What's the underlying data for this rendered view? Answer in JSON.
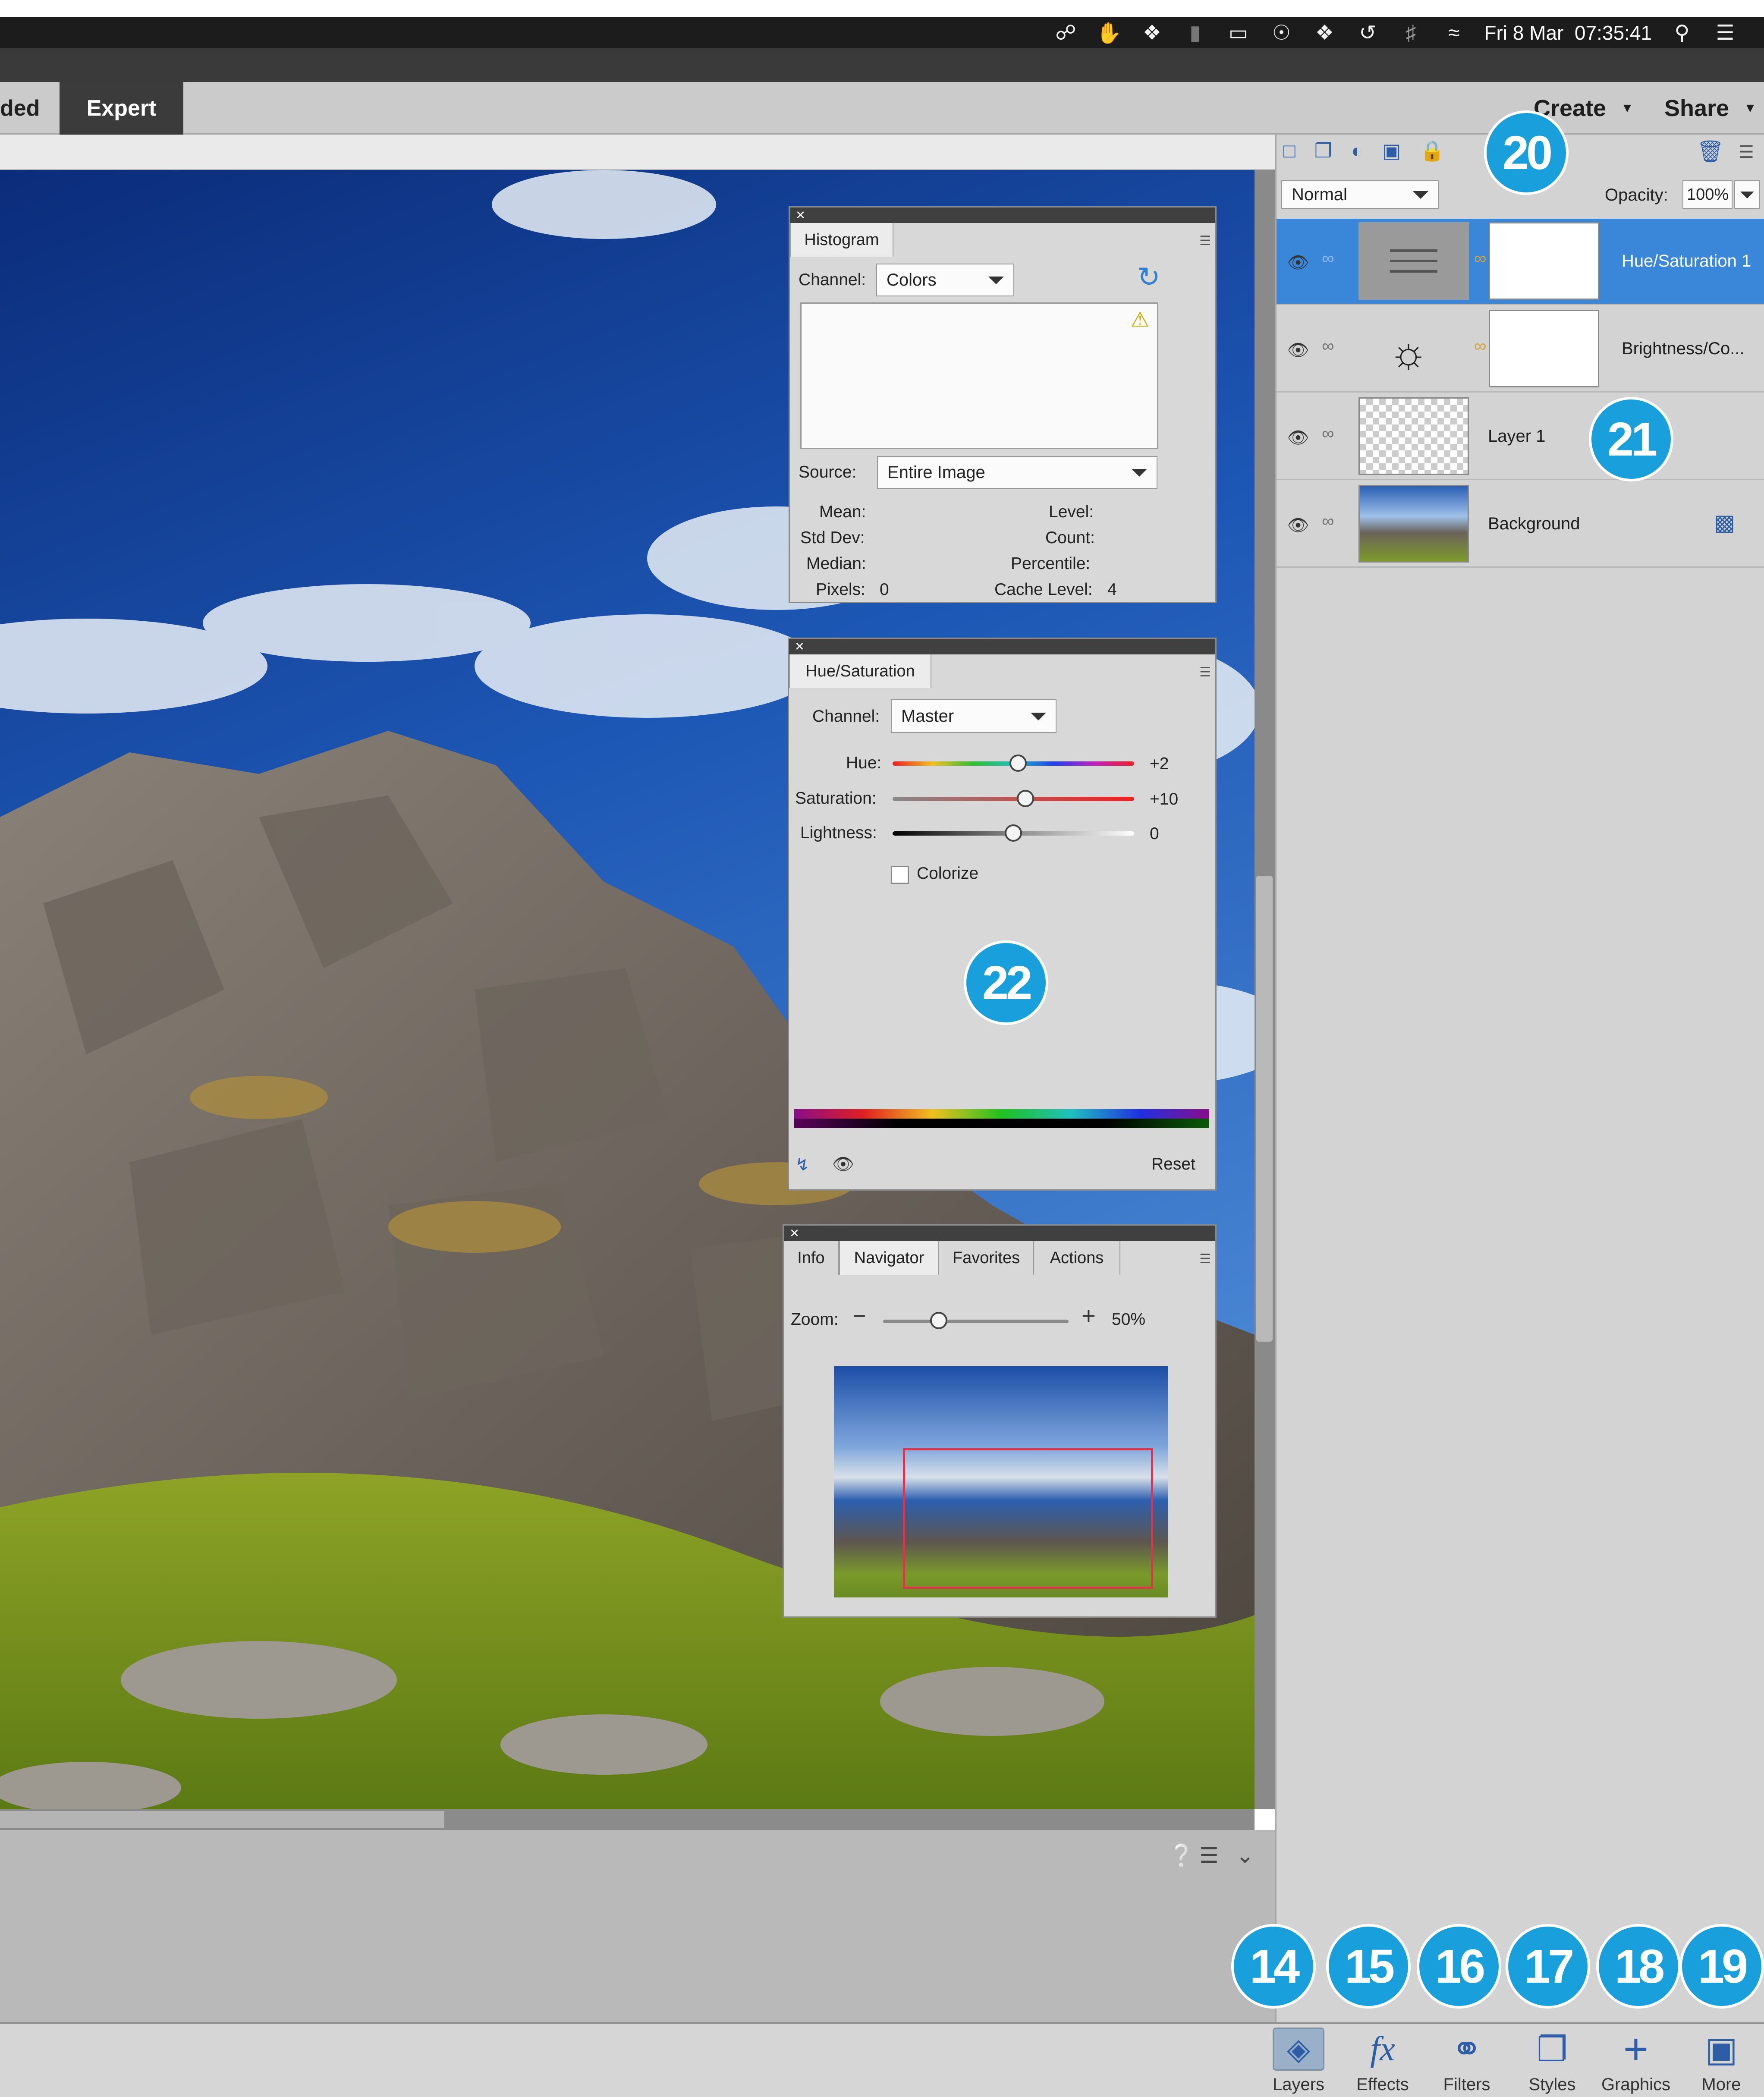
{
  "menubar": {
    "icons": [
      "creative-cloud-icon",
      "hand-icon",
      "dropbox-icon",
      "battery-icon",
      "airplay-icon",
      "accessibility-icon",
      "dropbox-alt-icon",
      "time-machine-icon",
      "bluetooth-icon",
      "wifi-icon"
    ],
    "clock": "Fri 8 Mar  07:35:41",
    "search_icon": "search-icon",
    "list_icon": "list-icon"
  },
  "modes": {
    "guided_partial": "ded",
    "expert": "Expert"
  },
  "topright": {
    "create": "Create",
    "share": "Share"
  },
  "histogram": {
    "tab": "Histogram",
    "channel_label": "Channel:",
    "channel_value": "Colors",
    "source_label": "Source:",
    "source_value": "Entire Image",
    "stats_left": [
      "Mean:",
      "Std Dev:",
      "Median:",
      "Pixels:"
    ],
    "pixels_value": "0",
    "stats_right": [
      "Level:",
      "Count:",
      "Percentile:",
      "Cache Level:"
    ],
    "cache_value": "4"
  },
  "huesat": {
    "tab": "Hue/Saturation",
    "channel_label": "Channel:",
    "channel_value": "Master",
    "hue_label": "Hue:",
    "hue_value": "+2",
    "sat_label": "Saturation:",
    "sat_value": "+10",
    "light_label": "Lightness:",
    "light_value": "0",
    "colorize": "Colorize",
    "reset": "Reset",
    "hue_level": 0.52,
    "sat_level": 0.55,
    "light_level": 0.5
  },
  "navigator": {
    "tabs": [
      "Info",
      "Navigator",
      "Favorites",
      "Actions"
    ],
    "zoom_label": "Zoom:",
    "zoom_value": "50%",
    "zoom_level": 0.3
  },
  "layers": {
    "blend_mode": "Normal",
    "opacity_label": "Opacity:",
    "opacity_value": "100%",
    "items": [
      {
        "name": "Hue/Saturation 1",
        "selected": true
      },
      {
        "name": "Brightness/Co...",
        "selected": false
      },
      {
        "name": "Layer 1",
        "selected": false
      },
      {
        "name": "Background",
        "selected": false
      }
    ]
  },
  "callouts": [
    "20",
    "21",
    "22",
    "14",
    "15",
    "16",
    "17",
    "18",
    "19"
  ],
  "toolbar": {
    "items": [
      "Layers",
      "Effects",
      "Filters",
      "Styles",
      "Graphics",
      "More"
    ]
  },
  "colors": {
    "callout": "#19a0dc",
    "selection": "#3a86d8",
    "menubar": "#1c1c1c"
  }
}
